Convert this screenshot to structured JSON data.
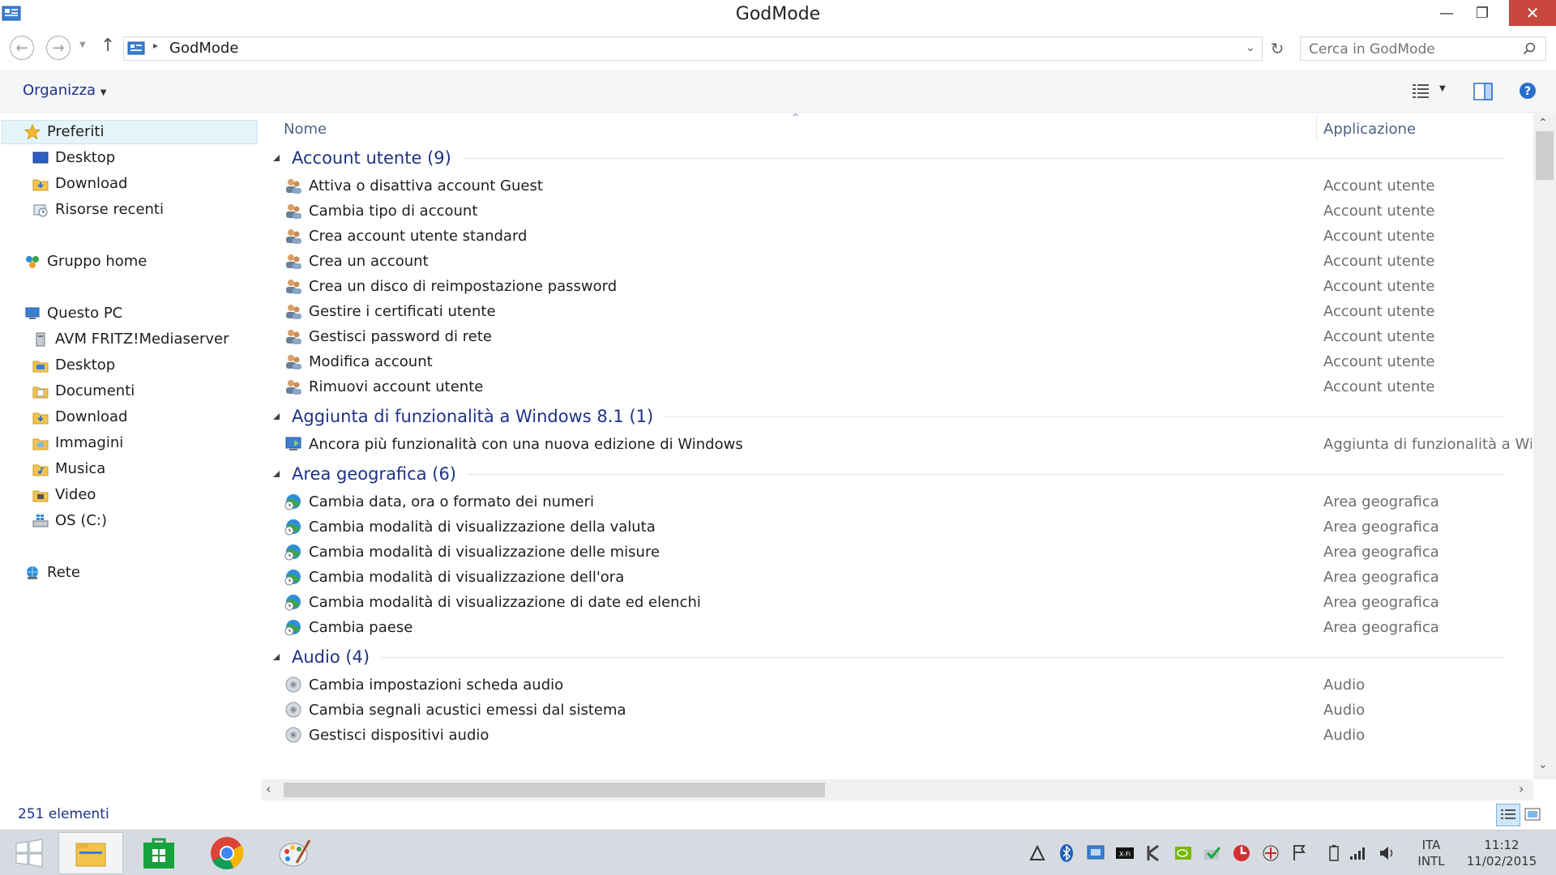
{
  "window": {
    "title": "GodMode"
  },
  "caption_buttons": {
    "minimize": "—",
    "maximize": "❐",
    "close": "✕"
  },
  "address": {
    "path": "GodMode"
  },
  "search": {
    "placeholder": "Cerca in GodMode"
  },
  "toolbar": {
    "organize_label": "Organizza"
  },
  "nav": {
    "favorites": {
      "label": "Preferiti",
      "items": [
        {
          "label": "Desktop",
          "icon": "desktop-icon"
        },
        {
          "label": "Download",
          "icon": "folder-download-icon"
        },
        {
          "label": "Risorse recenti",
          "icon": "recent-places-icon"
        }
      ]
    },
    "homegroup": {
      "label": "Gruppo home"
    },
    "thispc": {
      "label": "Questo PC",
      "items": [
        {
          "label": "AVM FRITZ!Mediaserver",
          "icon": "media-server-icon"
        },
        {
          "label": "Desktop",
          "icon": "folder-icon"
        },
        {
          "label": "Documenti",
          "icon": "folder-icon"
        },
        {
          "label": "Download",
          "icon": "folder-icon"
        },
        {
          "label": "Immagini",
          "icon": "folder-icon"
        },
        {
          "label": "Musica",
          "icon": "folder-icon"
        },
        {
          "label": "Video",
          "icon": "folder-icon"
        },
        {
          "label": "OS (C:)",
          "icon": "drive-icon"
        }
      ]
    },
    "network": {
      "label": "Rete"
    }
  },
  "columns": {
    "name": "Nome",
    "application": "Applicazione"
  },
  "groups": [
    {
      "title": "Account utente (9)",
      "icon": "users-icon",
      "items": [
        {
          "name": "Attiva o disattiva account Guest",
          "app": "Account utente"
        },
        {
          "name": "Cambia tipo di account",
          "app": "Account utente"
        },
        {
          "name": "Crea account utente standard",
          "app": "Account utente"
        },
        {
          "name": "Crea un account",
          "app": "Account utente"
        },
        {
          "name": "Crea un disco di reimpostazione password",
          "app": "Account utente"
        },
        {
          "name": "Gestire i certificati utente",
          "app": "Account utente"
        },
        {
          "name": "Gestisci password di rete",
          "app": "Account utente"
        },
        {
          "name": "Modifica account",
          "app": "Account utente"
        },
        {
          "name": "Rimuovi account utente",
          "app": "Account utente"
        }
      ]
    },
    {
      "title": "Aggiunta di funzionalità a Windows 8.1 (1)",
      "icon": "windows-features-icon",
      "items": [
        {
          "name": "Ancora più funzionalità con una nuova edizione di Windows",
          "app": "Aggiunta di funzionalità a Windo"
        }
      ]
    },
    {
      "title": "Area geografica (6)",
      "icon": "globe-clock-icon",
      "items": [
        {
          "name": "Cambia data, ora o formato dei numeri",
          "app": "Area geografica"
        },
        {
          "name": "Cambia modalità di visualizzazione della valuta",
          "app": "Area geografica"
        },
        {
          "name": "Cambia modalità di visualizzazione delle misure",
          "app": "Area geografica"
        },
        {
          "name": "Cambia modalità di visualizzazione dell'ora",
          "app": "Area geografica"
        },
        {
          "name": "Cambia modalità di visualizzazione di date ed elenchi",
          "app": "Area geografica"
        },
        {
          "name": "Cambia paese",
          "app": "Area geografica"
        }
      ]
    },
    {
      "title": "Audio (4)",
      "icon": "speaker-icon",
      "items": [
        {
          "name": "Cambia impostazioni scheda audio",
          "app": "Audio"
        },
        {
          "name": "Cambia segnali acustici emessi dal sistema",
          "app": "Audio"
        },
        {
          "name": "Gestisci dispositivi audio",
          "app": "Audio"
        }
      ]
    }
  ],
  "status": {
    "count": "251 elementi"
  },
  "clock": {
    "lang_top": "ITA",
    "lang_bottom": "INTL",
    "time": "11:12",
    "date": "11/02/2015"
  },
  "colors": {
    "group_header": "#1e3287",
    "taskbar": "#d7dbe1",
    "close": "#c7473c"
  }
}
